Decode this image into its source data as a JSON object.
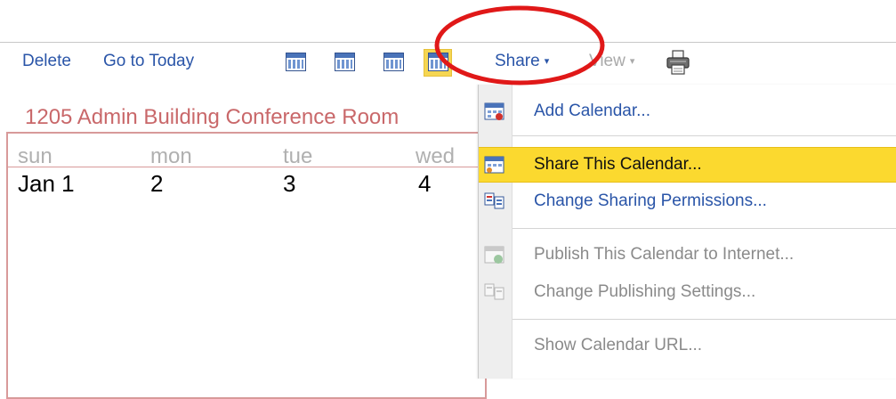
{
  "toolbar": {
    "delete_label": "Delete",
    "go_to_today_label": "Go to Today",
    "share_label": "Share",
    "view_label": "View",
    "caret": "▾",
    "view_icons": [
      "day-view-icon",
      "week-view-icon",
      "month-view-icon",
      "agenda-view-icon"
    ],
    "active_view_icon": "agenda-view-icon",
    "print_icon": "printer-icon"
  },
  "calendar": {
    "title": "1205 Admin Building Conference Room",
    "weekdays": [
      "sun",
      "mon",
      "tue",
      "wed"
    ],
    "dates": [
      "Jan 1",
      "2",
      "3",
      "4"
    ]
  },
  "share_menu": {
    "items": [
      {
        "label": "Add Calendar...",
        "icon": "add-calendar-icon",
        "state": "enabled"
      },
      {
        "label": "Share This Calendar...",
        "icon": "share-calendar-icon",
        "state": "highlighted"
      },
      {
        "label": "Change Sharing Permissions...",
        "icon": "sharing-permissions-icon",
        "state": "enabled"
      },
      {
        "label": "Publish This Calendar to Internet...",
        "icon": "publish-calendar-icon",
        "state": "disabled"
      },
      {
        "label": "Change Publishing Settings...",
        "icon": "publishing-settings-icon",
        "state": "disabled"
      },
      {
        "label": "Show Calendar URL...",
        "icon": "",
        "state": "disabled"
      }
    ]
  },
  "colors": {
    "link": "#2a55a8",
    "disabled": "#a9a9a9",
    "calendar_title": "#c9686a",
    "calendar_border": "#d89a9a",
    "highlight": "#fbd92f",
    "annotation": "#e01818"
  },
  "annotation": {
    "shape": "ellipse",
    "color": "#e01818",
    "target": "share-menu-button"
  }
}
